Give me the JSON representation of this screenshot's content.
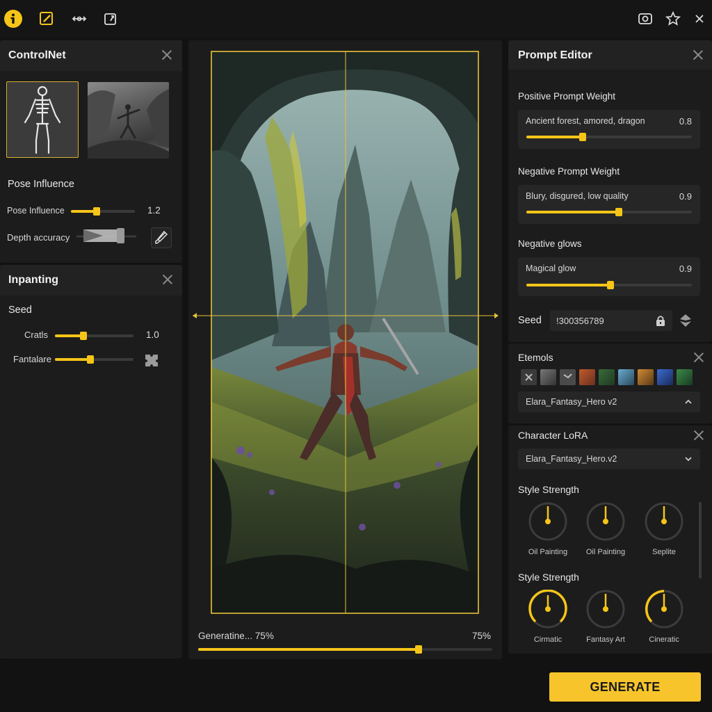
{
  "colors": {
    "accent": "#f5c518",
    "background": "#121212",
    "panel": "#1c1c1c"
  },
  "toolbar": {
    "icons": [
      "info-icon",
      "edit-icon",
      "transform-icon",
      "export-icon",
      "screenshot-icon",
      "star-icon",
      "close-icon"
    ]
  },
  "controlnet": {
    "title": "ControlNet",
    "thumbnails": [
      "skeleton-pose",
      "depth-map"
    ],
    "pose_heading": "Pose Influence",
    "pose_label": "Pose Influence",
    "pose_value": "1.2",
    "pose_level": 0.4,
    "depth_label": "Depth accuracy"
  },
  "inpainting": {
    "title": "Inpanting",
    "seed_heading": "Seed",
    "crafts_label": "Cratls",
    "crafts_value": "1.0",
    "crafts_level": 0.36,
    "fantasy_label": "Fantalare",
    "fantasy_level": 0.45
  },
  "canvas": {
    "progress_text": "Generatine... 75%",
    "progress_value": "75%",
    "progress_level": 0.75
  },
  "prompt_editor": {
    "title": "Prompt Editor",
    "positive_heading": "Positive Prompt Weight",
    "positive_text": "Ancient forest, amored, dragon",
    "positive_value": "0.8",
    "positive_level": 0.34,
    "negative_heading": "Negative Prompt Weight",
    "negative_text": "Blury, disgured, low quality",
    "negative_value": "0.9",
    "negative_level": 0.56,
    "glows_heading": "Negative glows",
    "glows_text": "Magical glow",
    "glows_value": "0.9",
    "glows_level": 0.51,
    "seed_label": "Seed",
    "seed_value": "!300356789"
  },
  "stemols": {
    "title": "Etemols",
    "select_value": "Elara_Fantasy_Hero v2"
  },
  "lora": {
    "title": "Character LoRA",
    "select_value": "Elara_Fantasy_Hero.v2",
    "style_heading_1": "Style Strength",
    "knobs_1": [
      "Oil Painting",
      "Oil Painting",
      "Seplite"
    ],
    "style_heading_2": "Style Strength",
    "knobs_2": [
      "Cirmatic",
      "Fantasy Art",
      "Cineratic"
    ]
  },
  "generate_label": "GENERATE"
}
